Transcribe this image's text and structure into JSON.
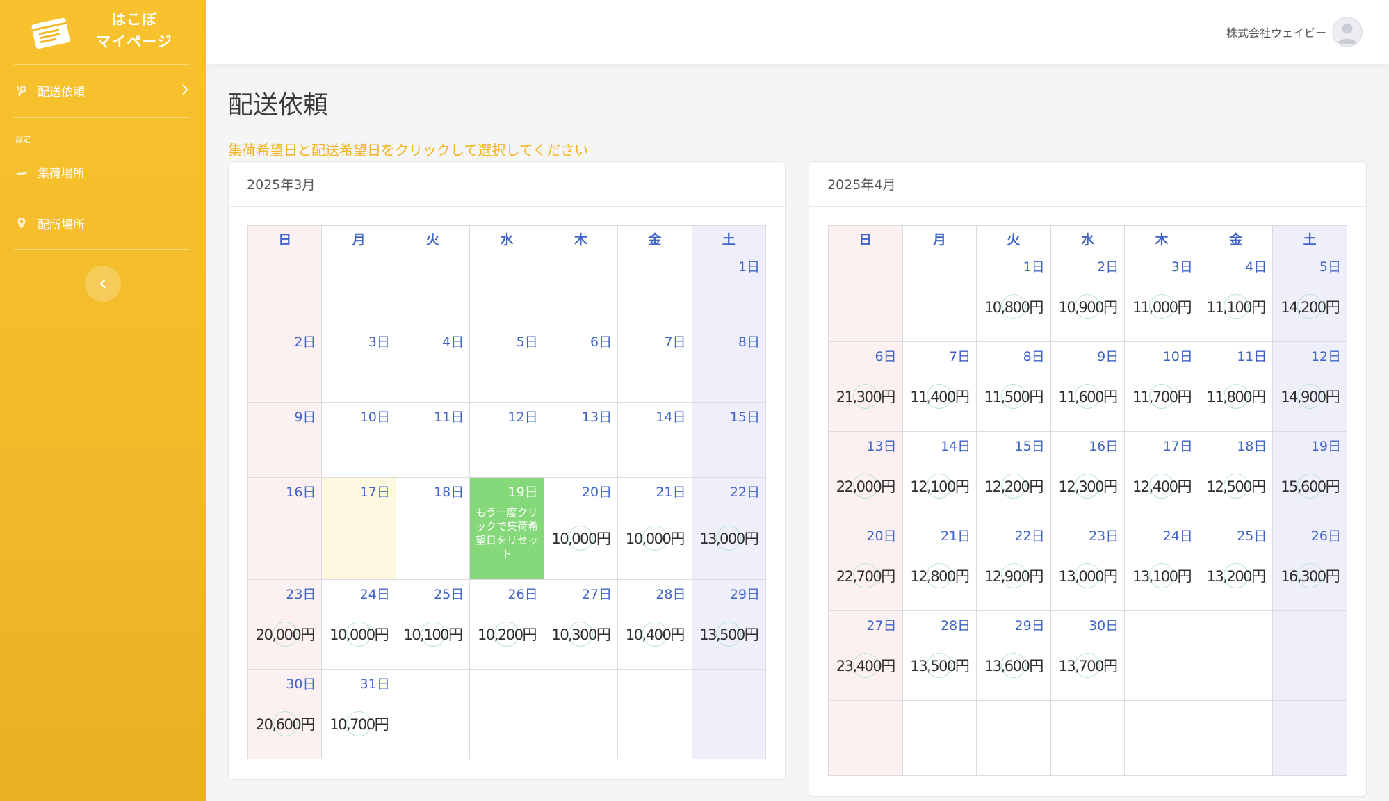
{
  "sidebar": {
    "brand_line1": "はこぼ",
    "brand_line2": "マイページ",
    "brand_icon": "parcel-logo-icon",
    "nav_delivery_label": "配送依頼",
    "settings_heading": "設定",
    "nav_pickup_label": "集荷場所",
    "nav_dropoff_label": "配所場所",
    "collapse_icon": "chevron-left-icon"
  },
  "topbar": {
    "company": "株式会社ウェイビー",
    "avatar_icon": "user-avatar-icon"
  },
  "page": {
    "title": "配送依頼",
    "instruction": "集荷希望日と配送希望日をクリックして選択してください"
  },
  "weekdays": [
    "日",
    "月",
    "火",
    "水",
    "木",
    "金",
    "土"
  ],
  "colors": {
    "accent": "#f3b41e",
    "weekday_blue": "#3f63c7",
    "sunday_bg": "#fdf0f0",
    "saturday_bg": "#efeffb",
    "selected_green": "#86d97a",
    "today_yellow": "#fff8e1"
  },
  "march": {
    "title": "2025年3月",
    "weeks": [
      [
        null,
        null,
        null,
        null,
        null,
        null,
        {
          "day": "1日"
        }
      ],
      [
        {
          "day": "2日"
        },
        {
          "day": "3日"
        },
        {
          "day": "4日"
        },
        {
          "day": "5日"
        },
        {
          "day": "6日"
        },
        {
          "day": "7日"
        },
        {
          "day": "8日"
        }
      ],
      [
        {
          "day": "9日"
        },
        {
          "day": "10日"
        },
        {
          "day": "11日"
        },
        {
          "day": "12日"
        },
        {
          "day": "13日"
        },
        {
          "day": "14日"
        },
        {
          "day": "15日"
        }
      ],
      [
        {
          "day": "16日"
        },
        {
          "day": "17日",
          "state": "today"
        },
        {
          "day": "18日"
        },
        {
          "day": "19日",
          "state": "selected",
          "note": "もう一度クリックで集荷希望日をリセット"
        },
        {
          "day": "20日",
          "price": "10,000円"
        },
        {
          "day": "21日",
          "price": "10,000円"
        },
        {
          "day": "22日",
          "price": "13,000円"
        }
      ],
      [
        {
          "day": "23日",
          "price": "20,000円"
        },
        {
          "day": "24日",
          "price": "10,000円"
        },
        {
          "day": "25日",
          "price": "10,100円"
        },
        {
          "day": "26日",
          "price": "10,200円"
        },
        {
          "day": "27日",
          "price": "10,300円"
        },
        {
          "day": "28日",
          "price": "10,400円"
        },
        {
          "day": "29日",
          "price": "13,500円"
        }
      ],
      [
        {
          "day": "30日",
          "price": "20,600円"
        },
        {
          "day": "31日",
          "price": "10,700円"
        },
        null,
        null,
        null,
        null,
        null
      ]
    ]
  },
  "april": {
    "title": "2025年4月",
    "weeks": [
      [
        null,
        null,
        {
          "day": "1日",
          "price": "10,800円"
        },
        {
          "day": "2日",
          "price": "10,900円"
        },
        {
          "day": "3日",
          "price": "11,000円"
        },
        {
          "day": "4日",
          "price": "11,100円"
        },
        {
          "day": "5日",
          "price": "14,200円"
        }
      ],
      [
        {
          "day": "6日",
          "price": "21,300円"
        },
        {
          "day": "7日",
          "price": "11,400円"
        },
        {
          "day": "8日",
          "price": "11,500円"
        },
        {
          "day": "9日",
          "price": "11,600円"
        },
        {
          "day": "10日",
          "price": "11,700円"
        },
        {
          "day": "11日",
          "price": "11,800円"
        },
        {
          "day": "12日",
          "price": "14,900円"
        }
      ],
      [
        {
          "day": "13日",
          "price": "22,000円"
        },
        {
          "day": "14日",
          "price": "12,100円"
        },
        {
          "day": "15日",
          "price": "12,200円"
        },
        {
          "day": "16日",
          "price": "12,300円"
        },
        {
          "day": "17日",
          "price": "12,400円"
        },
        {
          "day": "18日",
          "price": "12,500円"
        },
        {
          "day": "19日",
          "price": "15,600円"
        }
      ],
      [
        {
          "day": "20日",
          "price": "22,700円"
        },
        {
          "day": "21日",
          "price": "12,800円"
        },
        {
          "day": "22日",
          "price": "12,900円"
        },
        {
          "day": "23日",
          "price": "13,000円"
        },
        {
          "day": "24日",
          "price": "13,100円"
        },
        {
          "day": "25日",
          "price": "13,200円"
        },
        {
          "day": "26日",
          "price": "16,300円"
        }
      ],
      [
        {
          "day": "27日",
          "price": "23,400円"
        },
        {
          "day": "28日",
          "price": "13,500円"
        },
        {
          "day": "29日",
          "price": "13,600円"
        },
        {
          "day": "30日",
          "price": "13,700円"
        },
        null,
        null,
        null
      ],
      [
        null,
        null,
        null,
        null,
        null,
        null,
        null
      ]
    ]
  }
}
